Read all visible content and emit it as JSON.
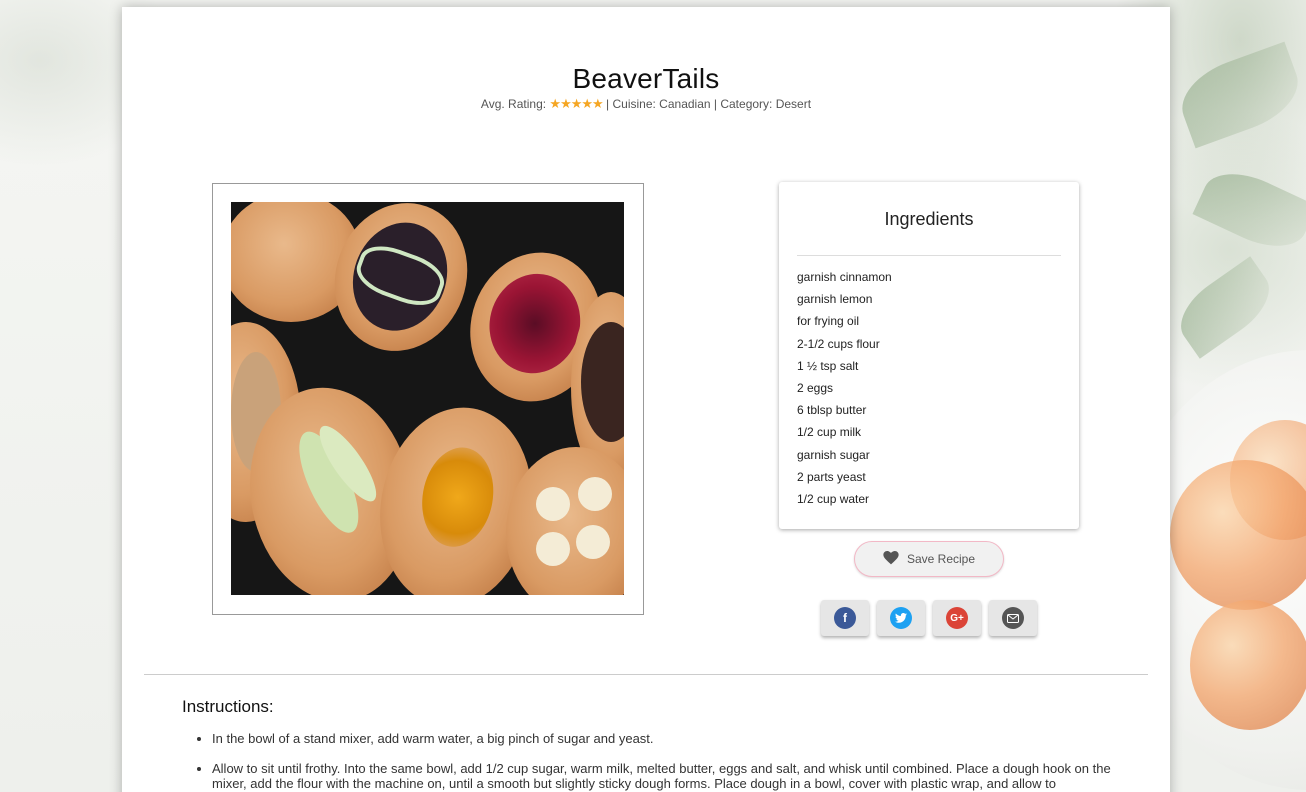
{
  "recipe": {
    "title": "BeaverTails",
    "rating_prefix": "Avg. Rating:",
    "stars": "★★★★★",
    "cuisine_text": "| Cuisine: Canadian | Category: Desert"
  },
  "ingredients": {
    "heading": "Ingredients",
    "items": [
      "garnish cinnamon",
      "garnish lemon",
      "for frying oil",
      "2-1/2 cups flour",
      "1 ½ tsp salt",
      "2 eggs",
      "6 tblsp butter",
      "1/2 cup milk",
      "garnish sugar",
      "2 parts yeast",
      "1/2 cup water"
    ]
  },
  "actions": {
    "save_label": "Save Recipe"
  },
  "share": {
    "facebook_glyph": "f",
    "gplus_glyph": "G+"
  },
  "instructions": {
    "heading": "Instructions:",
    "steps": [
      "In the bowl of a stand mixer, add warm water, a big pinch of sugar and yeast.",
      "Allow to sit until frothy. Into the same bowl, add 1/2 cup sugar, warm milk, melted butter, eggs and salt, and whisk until combined. Place a dough hook on the mixer, add the flour with the machine on, until a smooth but slightly sticky dough forms. Place dough in a bowl, cover with plastic wrap, and allow to"
    ]
  },
  "colors": {
    "star": "#f5a623",
    "facebook": "#3b5998",
    "twitter": "#1da1f2",
    "gplus": "#db4437",
    "email": "#555555",
    "heart": "#555555"
  },
  "icons": [
    "heart-icon",
    "facebook-icon",
    "twitter-icon",
    "google-plus-icon",
    "email-icon"
  ]
}
